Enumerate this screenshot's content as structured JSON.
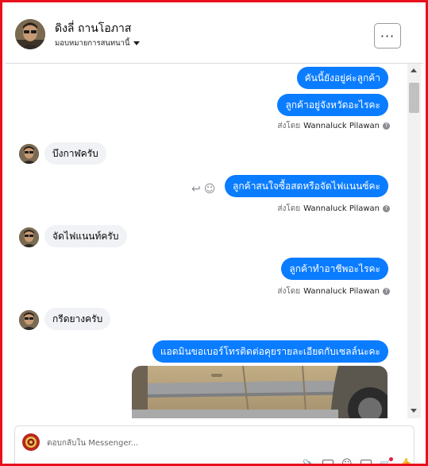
{
  "header": {
    "name": "ดิงลี่ ถานโอภาส",
    "subtitle": "มอบหมายการสนทนานี้",
    "more_label": "···"
  },
  "messages": [
    {
      "text": "คันนี้ยังอยู่ค่ะลูกค้า",
      "direction": "out"
    },
    {
      "text": "ลูกค้าอยู่จังหวัดอะไรคะ",
      "direction": "out"
    },
    {
      "text": "บึงกาฬครับ",
      "direction": "in"
    },
    {
      "text": "ลูกค้าสนใจซื้อสดหรือจัดไฟแนนซ์คะ",
      "direction": "out"
    },
    {
      "text": "จัดไฟแนนท์ครับ",
      "direction": "in"
    },
    {
      "text": "ลูกค้าทำอาชีพอะไรคะ",
      "direction": "out"
    },
    {
      "text": "กรีดยางครับ",
      "direction": "in"
    },
    {
      "text": "แอดมินขอเบอร์โทรติดต่อคุยรายละเอียดกับเซลล์นะคะ",
      "direction": "out"
    }
  ],
  "sent_by": {
    "prefix": "ส่งโดย",
    "name": "Wannaluck Pilawan"
  },
  "composer": {
    "placeholder": "ตอบกลับใน Messenger..."
  },
  "colors": {
    "outgoing_bubble": "#0a7cff",
    "incoming_bubble": "#f0f2f5",
    "frame_border": "#e8101c"
  }
}
